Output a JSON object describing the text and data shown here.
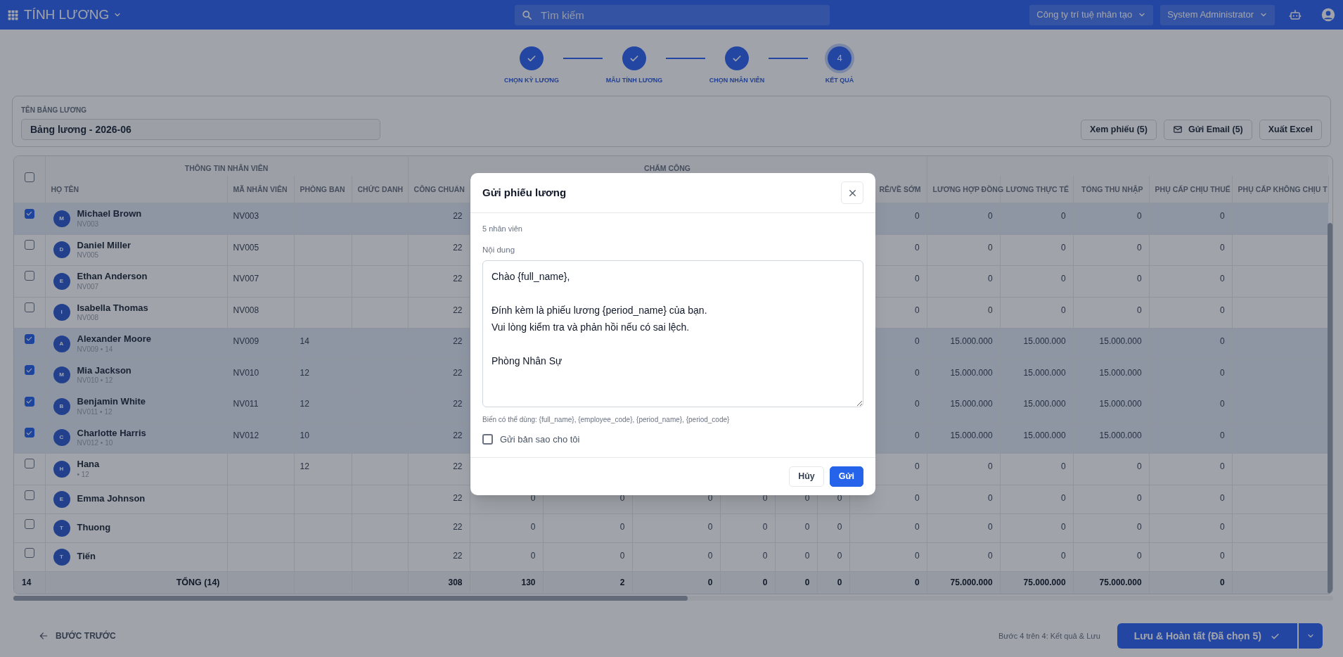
{
  "app_bar": {
    "title": "TÍNH LƯƠNG",
    "search": {
      "placeholder": "Tìm kiếm"
    },
    "company": "Công ty trí tuệ nhân tạo",
    "user": "System Administrator"
  },
  "steps": [
    {
      "label": "CHỌN KỲ LƯƠNG",
      "completed": true
    },
    {
      "label": "MẪU TÍNH LƯƠNG",
      "completed": true
    },
    {
      "label": "CHỌN NHÂN VIÊN",
      "completed": true
    },
    {
      "label": "KẾT QUẢ",
      "completed": false,
      "number": "4"
    }
  ],
  "payroll_name": {
    "label": "TÊN BẢNG LƯƠNG",
    "value": "Bảng lương - 2026-06"
  },
  "actions": [
    {
      "label": "Xem phiếu (5)",
      "kind": "plain"
    },
    {
      "label": "Gửi Email (5)",
      "kind": "mail"
    },
    {
      "label": "Xuất Excel",
      "kind": "plain"
    }
  ],
  "table": {
    "select_all": {
      "checked": false
    },
    "groups": [
      "THÔNG TIN NHÂN VIÊN",
      "CHẤM CÔNG"
    ],
    "columns": [
      "HỌ TÊN",
      "MÃ NHÂN VIÊN",
      "PHÒNG BAN",
      "CHỨC DANH",
      "CÔNG CHUẨN",
      "RỄ/VỀ SỚM",
      "LƯƠNG HỢP ĐỒNG",
      "LƯƠNG THỰC TẾ",
      "TỔNG THU NHẬP",
      "PHỤ CẤP CHỊU THUẾ",
      "PHỤ CẤP KHÔNG CHỊU T"
    ],
    "rows": [
      {
        "checked": true,
        "avatar": "M",
        "name": "Michael Brown",
        "sub": "NV003",
        "code": "NV003",
        "standard": "22",
        "pay": [
          "0",
          "0",
          "0",
          "0",
          "0"
        ]
      },
      {
        "checked": false,
        "avatar": "D",
        "name": "Daniel Miller",
        "sub": "NV005",
        "code": "NV005",
        "standard": "22",
        "pay": [
          "0",
          "0",
          "0",
          "0",
          "0"
        ]
      },
      {
        "checked": false,
        "avatar": "E",
        "name": "Ethan Anderson",
        "sub": "NV007",
        "code": "NV007",
        "standard": "22",
        "pay": [
          "0",
          "0",
          "0",
          "0",
          "0"
        ]
      },
      {
        "checked": false,
        "avatar": "I",
        "name": "Isabella Thomas",
        "sub": "NV008",
        "code": "NV008",
        "standard": "22",
        "pay": [
          "0",
          "0",
          "0",
          "0",
          "0"
        ]
      },
      {
        "checked": true,
        "avatar": "A",
        "name": "Alexander Moore",
        "sub": "NV009 • 14",
        "code": "NV009",
        "department": "14",
        "standard": "22",
        "pay": [
          "0",
          "15.000.000",
          "15.000.000",
          "15.000.000",
          "0"
        ]
      },
      {
        "checked": true,
        "avatar": "M",
        "name": "Mia Jackson",
        "sub": "NV010 • 12",
        "code": "NV010",
        "department": "12",
        "standard": "22",
        "pay": [
          "0",
          "15.000.000",
          "15.000.000",
          "15.000.000",
          "0"
        ]
      },
      {
        "checked": true,
        "avatar": "B",
        "name": "Benjamin White",
        "sub": "NV011 • 12",
        "code": "NV011",
        "department": "12",
        "standard": "22",
        "pay": [
          "0",
          "15.000.000",
          "15.000.000",
          "15.000.000",
          "0"
        ]
      },
      {
        "checked": true,
        "avatar": "C",
        "name": "Charlotte Harris",
        "sub": "NV012 • 10",
        "code": "NV012",
        "department": "10",
        "standard": "22",
        "pay": [
          "0",
          "15.000.000",
          "15.000.000",
          "15.000.000",
          "0"
        ]
      },
      {
        "checked": false,
        "avatar": "H",
        "name": "Hana",
        "sub": "• 12",
        "department": "12",
        "standard": "22",
        "pay": [
          "0",
          "0",
          "0",
          "0",
          "0"
        ]
      },
      {
        "checked": false,
        "avatar": "E",
        "name": "Emma Johnson",
        "standard": "22",
        "attendance": [
          "0",
          "0",
          "0",
          "0",
          "0",
          "0"
        ],
        "pay": [
          "0",
          "0",
          "0",
          "0",
          "0"
        ]
      },
      {
        "checked": false,
        "avatar": "T",
        "name": "Thuong",
        "standard": "22",
        "attendance": [
          "0",
          "0",
          "0",
          "0",
          "0",
          "0"
        ],
        "pay": [
          "0",
          "0",
          "0",
          "0",
          "0"
        ]
      },
      {
        "checked": false,
        "avatar": "T",
        "name": "Tiến",
        "standard": "22",
        "attendance": [
          "0",
          "0",
          "0",
          "0",
          "0",
          "0"
        ],
        "pay": [
          "0",
          "0",
          "0",
          "0",
          "0"
        ]
      }
    ],
    "total": {
      "count": "14",
      "label": "TỔNG (14)",
      "standard": "308",
      "attendance": [
        "130",
        "2",
        "0",
        "0",
        "0",
        "0"
      ],
      "pay": [
        "0",
        "75.000.000",
        "75.000.000",
        "75.000.000",
        "0"
      ]
    }
  },
  "modal": {
    "title": "Gửi phiếu lương",
    "count": "5 nhân viên",
    "content_label": "Nội dung",
    "content": "Chào {full_name},\n\nĐính kèm là phiếu lương {period_name} của bạn.\nVui lòng kiểm tra và phản hồi nếu có sai lệch.\n\nPhòng Nhân Sự",
    "hint": "Biến có thể dùng: {full_name}, {employee_code}, {period_name}, {period_code}",
    "copy_to_me": {
      "label": "Gửi bản sao cho tôi",
      "checked": false
    },
    "buttons": [
      {
        "label": "Hủy",
        "kind": "secondary"
      },
      {
        "label": "Gửi",
        "kind": "primary"
      }
    ]
  },
  "footer": {
    "back": "BƯỚC TRƯỚC",
    "progress": "Bước 4 trên 4: Kết quả & Lưu",
    "finish": "Lưu & Hoàn tất (Đã chọn 5)"
  }
}
